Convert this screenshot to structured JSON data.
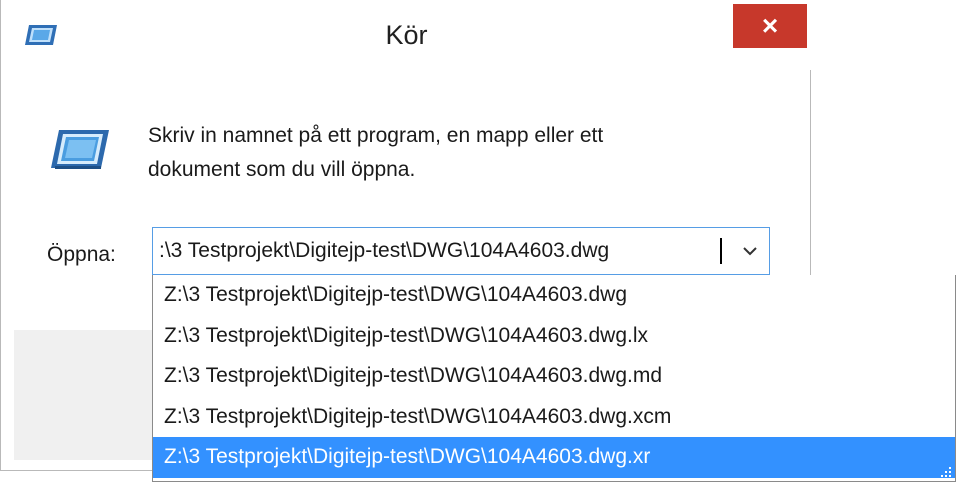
{
  "window": {
    "title": "Kör",
    "close_label": "×",
    "app_icon": "run-icon"
  },
  "body": {
    "instruction_line1": "Skriv in namnet på ett program, en mapp eller ett",
    "instruction_line2": "dokument som du vill öppna.",
    "big_icon": "run-icon"
  },
  "open_field": {
    "label": "Öppna:",
    "value": ":\\3 Testprojekt\\Digitejp-test\\DWG\\104A4603.dwg",
    "dropdown_icon": "chevron-down-icon"
  },
  "dropdown": {
    "items": [
      {
        "label": "Z:\\3 Testprojekt\\Digitejp-test\\DWG\\104A4603.dwg"
      },
      {
        "label": "Z:\\3 Testprojekt\\Digitejp-test\\DWG\\104A4603.dwg.lx"
      },
      {
        "label": "Z:\\3 Testprojekt\\Digitejp-test\\DWG\\104A4603.dwg.md"
      },
      {
        "label": "Z:\\3 Testprojekt\\Digitejp-test\\DWG\\104A4603.dwg.xcm"
      },
      {
        "label": "Z:\\3 Testprojekt\\Digitejp-test\\DWG\\104A4603.dwg.xr"
      }
    ],
    "selected_index": 4,
    "resize_grip_icon": "resize-grip-icon"
  },
  "colors": {
    "close_button": "#c7382b",
    "selection": "#3391ff",
    "input_border": "#569de5",
    "footer": "#f0f0f0"
  }
}
